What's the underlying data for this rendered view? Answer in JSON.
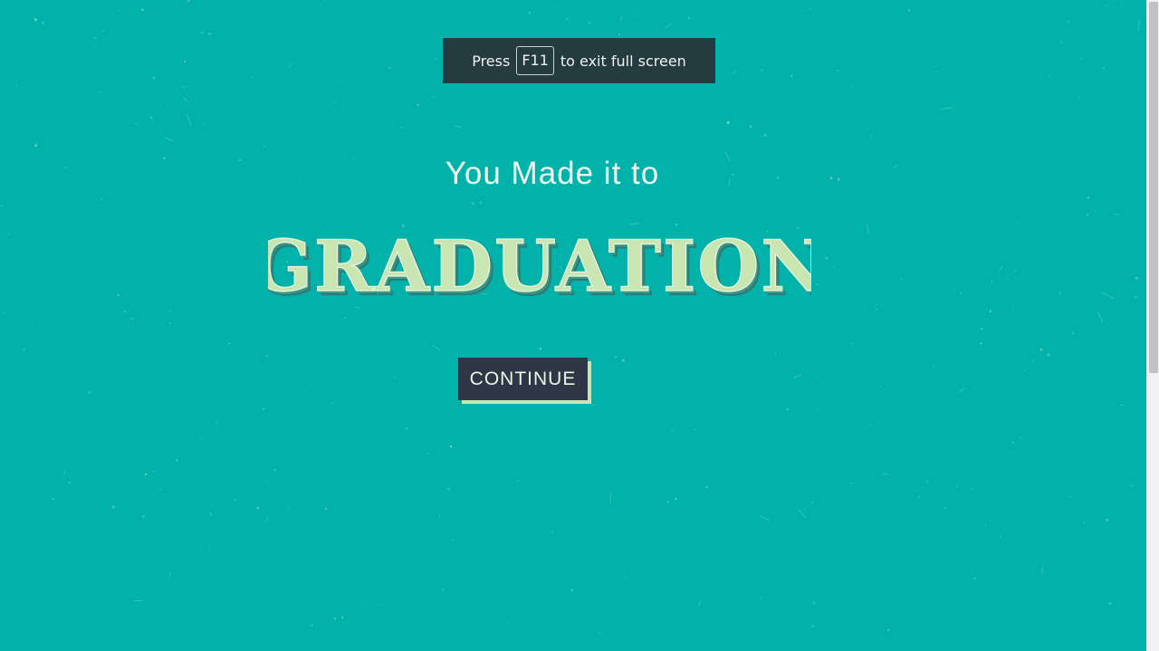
{
  "fullscreen_notice": {
    "before": "Press",
    "key": "F11",
    "after": "to exit full screen"
  },
  "intro_text": "You Made it to",
  "headline": "GRADUATION",
  "continue_label": "CONTINUE",
  "colors": {
    "background": "#00b2aa",
    "headline_fill": "#c9e6b2",
    "headline_shadow": "#2c7d74",
    "button_bg": "#2f3746",
    "button_shadow": "#c7e6b7"
  }
}
